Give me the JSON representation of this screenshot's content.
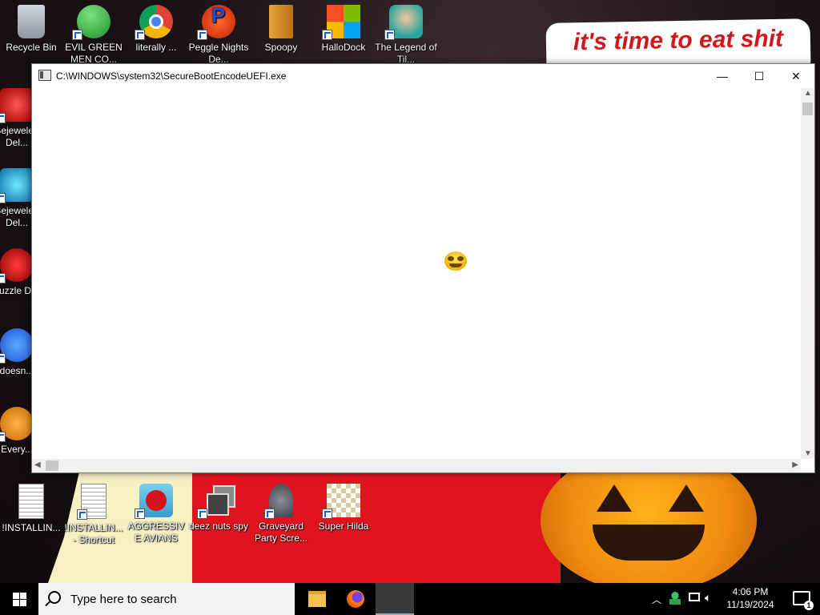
{
  "desktop": {
    "banner_text": "it's time to eat shit",
    "top_icons": [
      {
        "label": "Recycle Bin"
      },
      {
        "label": "EVIL GREEN MEN CO..."
      },
      {
        "label": "literally ..."
      },
      {
        "label": "Peggle Nights De..."
      },
      {
        "label": "Spoopy"
      },
      {
        "label": "HalloDock"
      },
      {
        "label": "The Legend of Til..."
      }
    ],
    "left_icons": [
      {
        "label": "Bejeweled Del..."
      },
      {
        "label": "Bejeweled Del..."
      },
      {
        "label": "Chuzzle Del..."
      },
      {
        "label": "doesn..."
      },
      {
        "label": "Every..."
      }
    ],
    "bottom_icons": [
      {
        "label": "!INSTALLIN..."
      },
      {
        "label": "!INSTALLIN... - Shortcut"
      },
      {
        "label": "AGGRESSIVE AVIANS"
      },
      {
        "label": "deez nuts spy"
      },
      {
        "label": "Graveyard Party Scre..."
      },
      {
        "label": "Super Hilda"
      }
    ],
    "colors": {
      "banner_text": "#d2161c",
      "wallpaper_red": "#e0141e",
      "pumpkin": "#f08a10"
    }
  },
  "window": {
    "title": "C:\\WINDOWS\\system32\\SecureBootEncodeUEFI.exe",
    "minimize": "—",
    "maximize": "☐",
    "close": "✕",
    "content_icon": "grimace-emoji-icon"
  },
  "taskbar": {
    "search_placeholder": "Type here to search",
    "time": "4:06 PM",
    "date": "11/19/2024",
    "notification_count": "1",
    "apps": [
      "file-explorer-icon",
      "firefox-icon",
      "console-window"
    ]
  }
}
